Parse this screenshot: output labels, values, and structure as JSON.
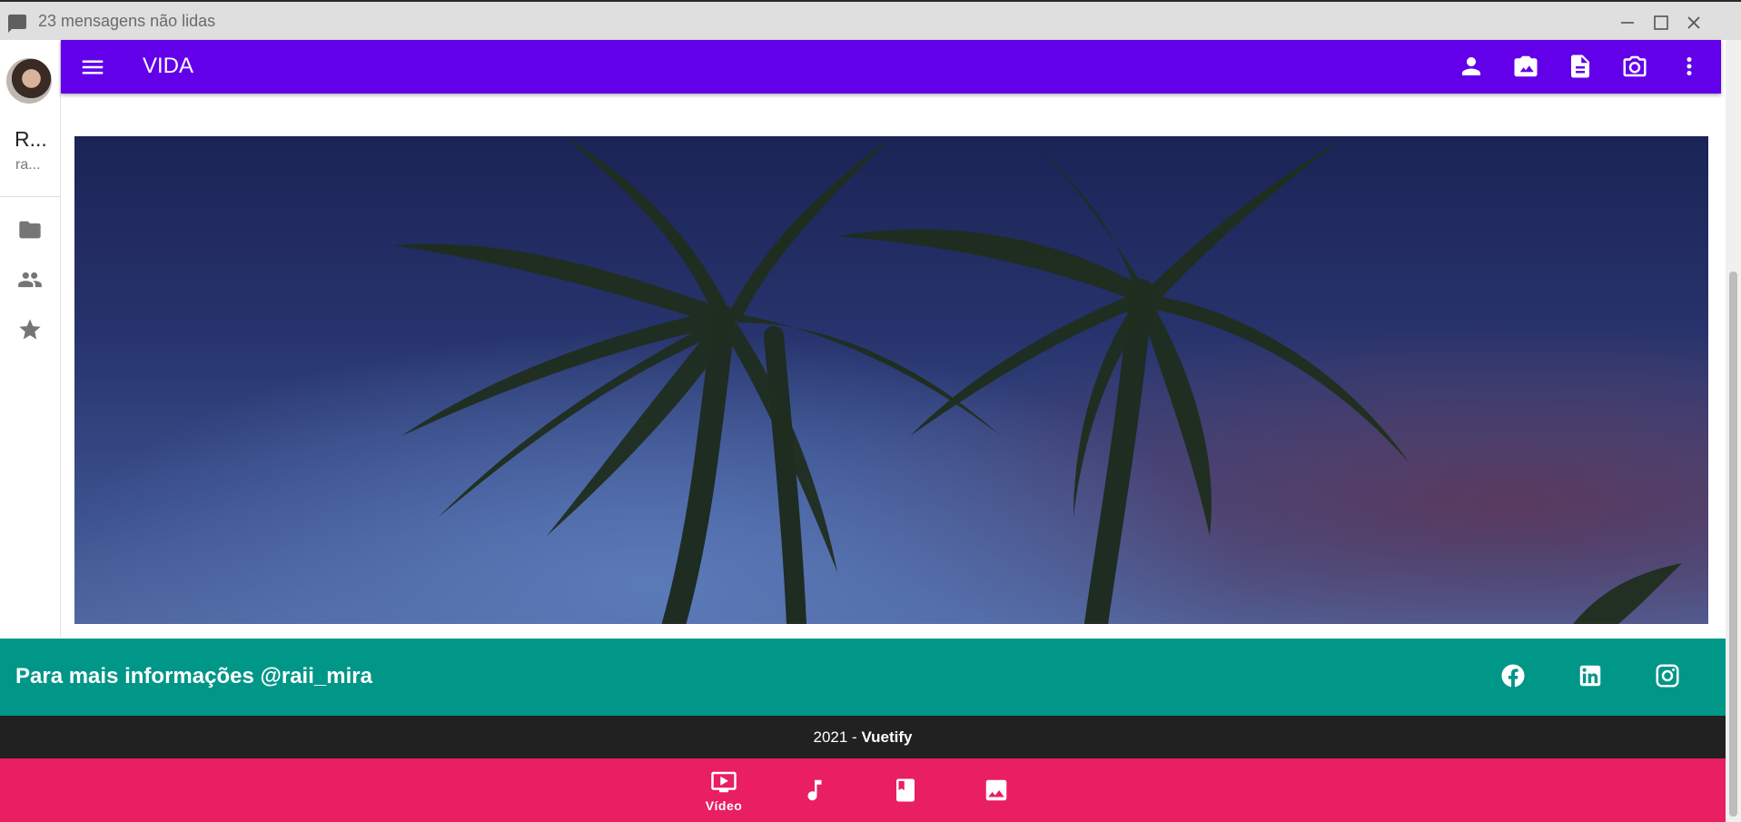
{
  "window": {
    "title": "23 mensagens não lidas"
  },
  "sidebar": {
    "name": "R...",
    "username": "ra...",
    "items": [
      {
        "icon": "folder-icon"
      },
      {
        "icon": "people-icon"
      },
      {
        "icon": "star-icon"
      }
    ]
  },
  "appbar": {
    "title": "VIDA",
    "color": "#6200ea",
    "actions": [
      "account-icon",
      "camera-image-icon",
      "document-icon",
      "camera-icon",
      "more-vert-icon"
    ]
  },
  "footer": {
    "info": "Para mais informações @raii_mira",
    "social": [
      "facebook-icon",
      "linkedin-icon",
      "instagram-icon"
    ],
    "color": "#009688"
  },
  "copyright": {
    "year": "2021 - ",
    "brand": "Vuetify"
  },
  "bottom_nav": {
    "color": "#e91e63",
    "items": [
      {
        "icon": "video-icon",
        "label": "Vídeo",
        "active": true
      },
      {
        "icon": "music-note-icon",
        "label": ""
      },
      {
        "icon": "book-icon",
        "label": ""
      },
      {
        "icon": "image-icon",
        "label": ""
      }
    ]
  }
}
